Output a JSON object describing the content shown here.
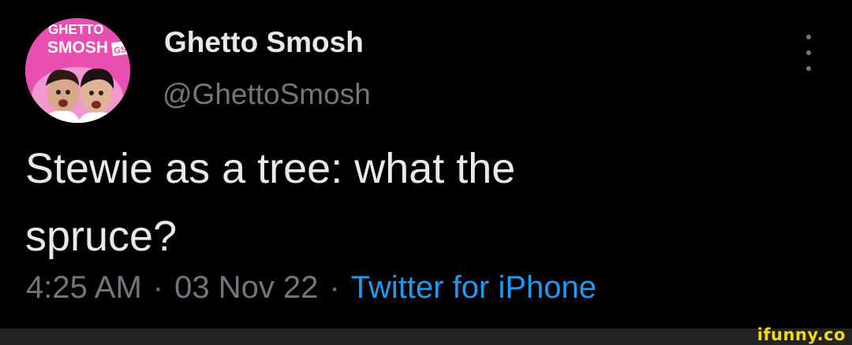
{
  "tweet": {
    "author": {
      "display_name": "Ghetto Smosh",
      "handle": "@GhettoSmosh",
      "avatar": {
        "logo_text_line1": "GHETTO",
        "logo_text_line2": "SMOSH",
        "logo_badge": "GS",
        "background_color": "#e84fb1"
      }
    },
    "text_lines": [
      "Stewie as a tree: what the",
      "spruce?"
    ],
    "meta": {
      "time": "4:25 AM",
      "separator": "·",
      "date": "03 Nov 22",
      "source": "Twitter for iPhone"
    },
    "more_icon": "more-vertical-icon"
  },
  "watermark": {
    "text": "ifunny.co"
  },
  "colors": {
    "background": "#000000",
    "primary_text": "#e7e9ea",
    "secondary_text": "#71767b",
    "link": "#1d9bf0",
    "watermark": "#f5d90f"
  }
}
